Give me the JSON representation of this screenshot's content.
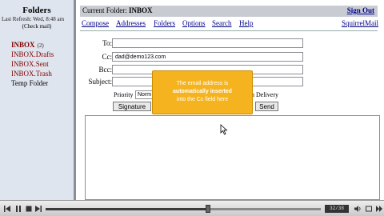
{
  "sidebar": {
    "title": "Folders",
    "last_refresh": "Last Refresh: Wed, 8:48 am",
    "check_mail": "(Check mail)",
    "folders": [
      {
        "label": "INBOX",
        "count": "(2)"
      },
      {
        "label": "INBOX.Drafts"
      },
      {
        "label": "INBOX.Sent"
      },
      {
        "label": "INBOX.Trash"
      },
      {
        "label": "Temp Folder"
      }
    ]
  },
  "header": {
    "current_folder_label": "Current Folder:",
    "current_folder": "INBOX",
    "sign_out": "Sign Out"
  },
  "nav": {
    "compose": "Compose",
    "addresses": "Addresses",
    "folders": "Folders",
    "options": "Options",
    "search": "Search",
    "help": "Help",
    "brand": "SquirrelMail"
  },
  "form": {
    "to_label": "To:",
    "to_value": "",
    "cc_label": "Cc:",
    "cc_value": "dad@demo123.com",
    "bcc_label": "Bcc:",
    "bcc_value": "",
    "subject_label": "Subject:",
    "subject_value": "",
    "priority_label": "Priority",
    "priority_value": "Norm",
    "delivery_label": "n Delivery",
    "signature_button": "Signature",
    "send_button": "Send"
  },
  "callout": {
    "line1": "The email address is",
    "line2": "automatically inserted",
    "line3": "into the Cc field here"
  },
  "player": {
    "counter": "32/38",
    "progress": 0.59
  },
  "colors": {
    "folder_link": "#800000",
    "nav_link": "#00008b",
    "callout": "#f5b41f",
    "sidebar_bg": "#dfe5ee"
  }
}
